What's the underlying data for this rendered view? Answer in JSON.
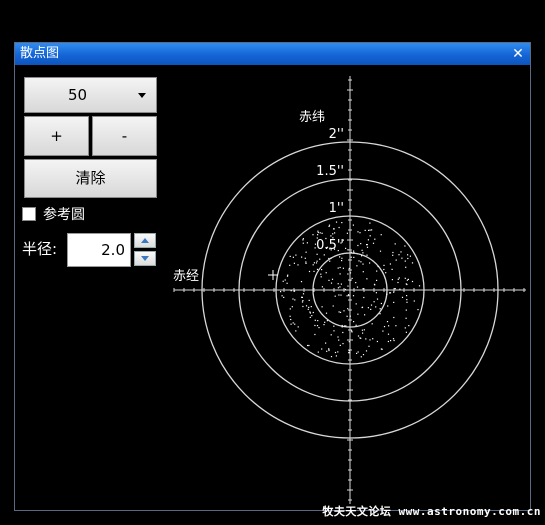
{
  "window": {
    "title": "散点图",
    "close_glyph": "✕"
  },
  "controls": {
    "count_value": "50",
    "plus_label": "+",
    "minus_label": "-",
    "clear_label": "清除",
    "ref_circle_label": "参考圆",
    "ref_circle_checked": false,
    "radius_label": "半径:",
    "radius_value": "2.0"
  },
  "plot": {
    "dec_axis_label": "赤纬",
    "ra_axis_label": "赤经",
    "circle_labels": [
      "0.5''",
      "1''",
      "1.5''",
      "2''"
    ],
    "circle_radii_arcsec": [
      0.5,
      1.0,
      1.5,
      2.0
    ],
    "point_count": 320,
    "point_color": "#ffffff",
    "grid_color": "#d8d8d8"
  },
  "watermark": "牧夫天文论坛 www.astronomy.com.cn",
  "colors": {
    "titlebar": "#1a6fe0",
    "background": "#000000"
  }
}
